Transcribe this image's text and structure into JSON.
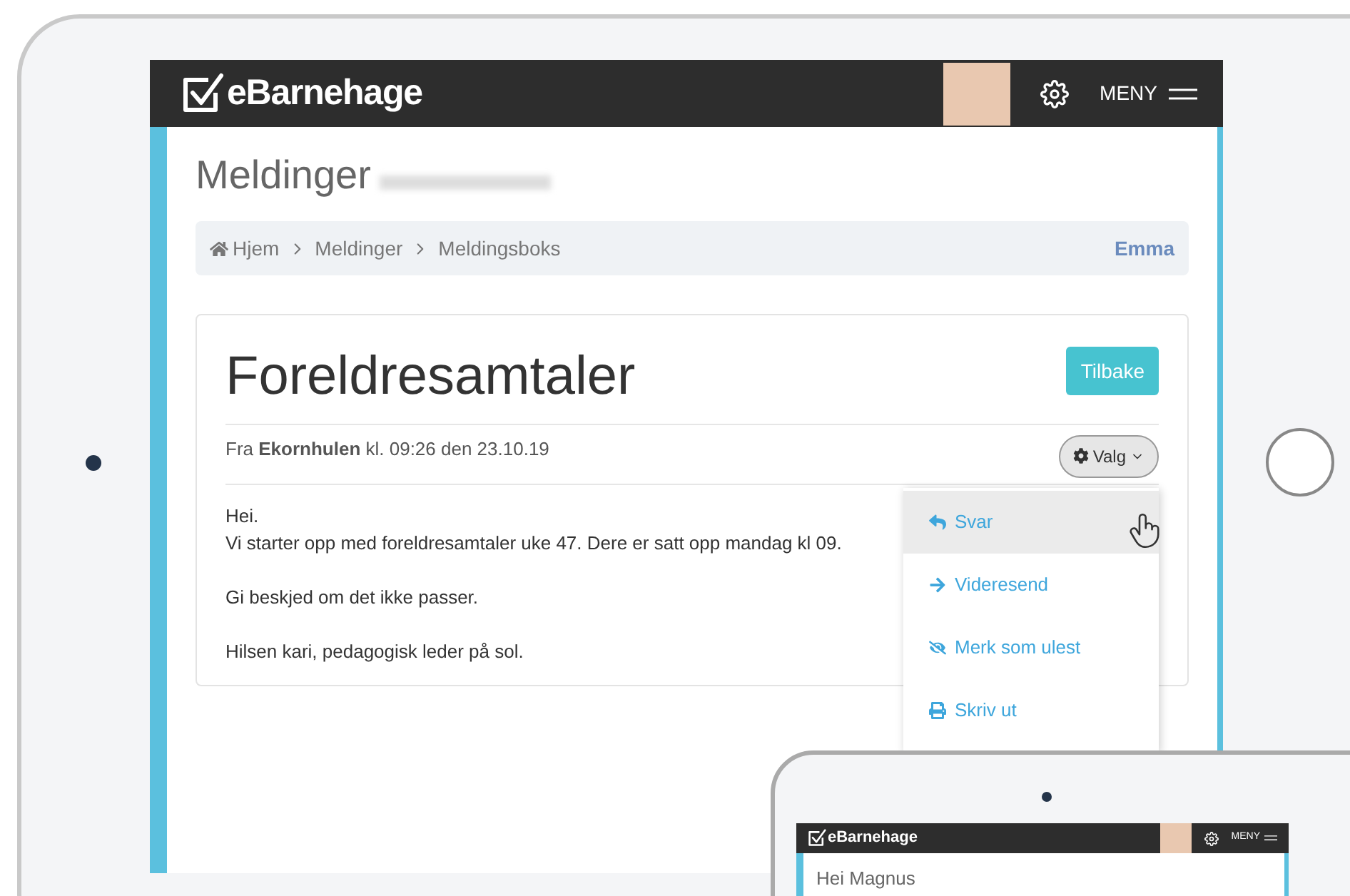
{
  "header": {
    "logo": "eBarnehage",
    "menu": "MENY"
  },
  "page": {
    "title": "Meldinger"
  },
  "breadcrumb": {
    "items": [
      "Hjem",
      "Meldinger",
      "Meldingsboks"
    ],
    "user": "Emma"
  },
  "message": {
    "title": "Foreldresamtaler",
    "back_button": "Tilbake",
    "meta": "Fra **Ekornhulen** kl. 09:26 den 23.10.19",
    "options_button": "Valg",
    "body": [
      "Hei.\nVi starter opp med foreldresamtaler uke 47. Dere er satt opp mandag kl 09.",
      "Gi beskjed om det ikke passer.",
      "Hilsen kari, pedagogisk leder på sol."
    ]
  },
  "options_menu": [
    {
      "label": "Svar",
      "hovered": true
    },
    {
      "label": "Videresend",
      "hovered": false
    },
    {
      "label": "Merk som ulest",
      "hovered": false
    },
    {
      "label": "Skriv ut",
      "hovered": false
    }
  ],
  "small_tablet": {
    "logo": "eBarnehage",
    "menu": "MENY",
    "greeting": "Hei Magnus"
  }
}
